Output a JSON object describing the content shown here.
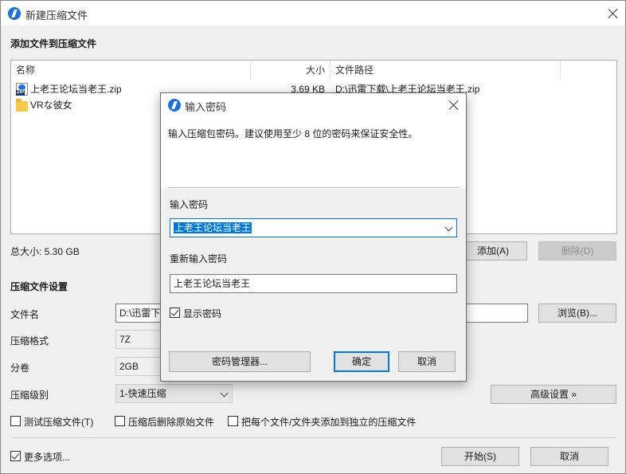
{
  "window": {
    "title": "新建压缩文件",
    "section_add": "添加文件到压缩文件",
    "columns": {
      "name": "名称",
      "size": "大小",
      "path": "文件路径"
    },
    "files": [
      {
        "name": "上老王论坛当老王.zip",
        "size": "3.69 KB",
        "path": "D:\\迅雷下载\\上老王论坛当老王.zip",
        "icon": "zip-file-icon"
      },
      {
        "name": "VRな彼女",
        "size": "",
        "path": "",
        "icon": "folder-icon"
      }
    ],
    "total_size": "总大小: 5.30 GB",
    "add_button": "添加(A)",
    "delete_button": "删除(D)",
    "section_settings": "压缩文件设置",
    "filename_label": "文件名",
    "filename_value": "D:\\迅雷下",
    "browse_button": "浏览(B)...",
    "format_label": "压缩格式",
    "format_value": "7Z",
    "volume_label": "分卷",
    "volume_value": "2GB",
    "level_label": "压缩级别",
    "level_value": "1-快速压缩",
    "advanced_button": "高级设置 »",
    "test_check": "测试压缩文件(T)",
    "delete_after_check": "压缩后删除原始文件",
    "separate_check": "把每个文件/文件夹添加到独立的压缩文件",
    "more_options": "更多选项...",
    "start_button": "开始(S)",
    "cancel_button": "取消"
  },
  "dialog": {
    "title": "输入密码",
    "info": "输入压缩包密码。建议使用至少 8 位的密码来保证安全性。",
    "password_label": "输入密码",
    "password_value": "上老王论坛当老王",
    "confirm_label": "重新输入密码",
    "confirm_value": "上老王论坛当老王",
    "show_password": "显示密码",
    "manager_button": "密码管理器...",
    "ok_button": "确定",
    "cancel_button": "取消"
  },
  "colors": {
    "accent": "#1e6fd9",
    "selection": "#0078d7",
    "focus_border": "#0078d7"
  }
}
